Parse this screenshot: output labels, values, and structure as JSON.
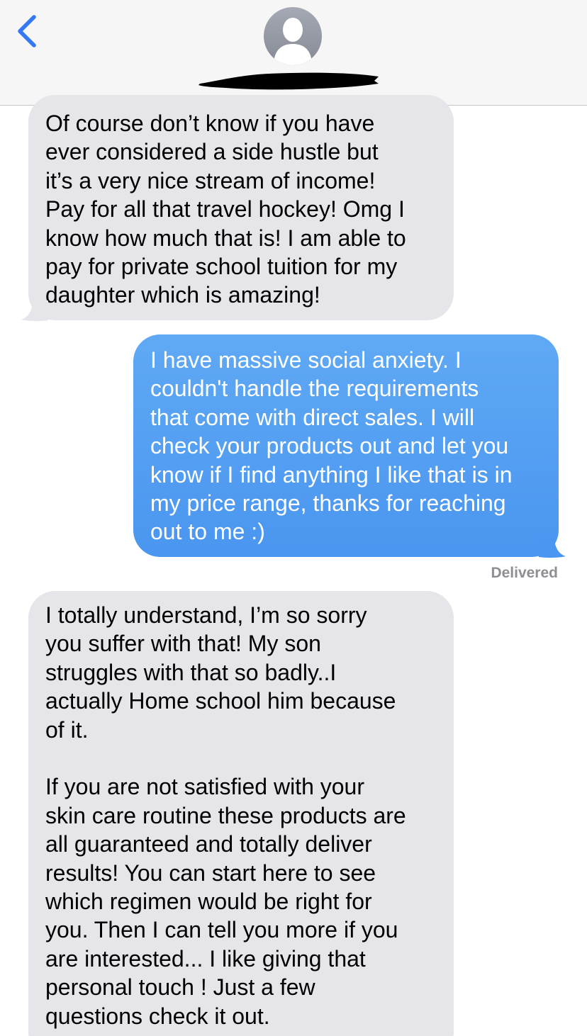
{
  "header": {
    "back_icon": "chevron-left-icon",
    "avatar_icon": "person-silhouette-icon",
    "contact_name_redacted": true
  },
  "messages": [
    {
      "direction": "incoming",
      "text": "Of course don’t know if you have\never considered a side hustle but\nit’s a very nice stream of income!\nPay for all that travel hockey! Omg I\nknow how much that is! I am able to\npay for private school tuition for my\ndaughter which is amazing!"
    },
    {
      "direction": "outgoing",
      "text": "I have massive social anxiety. I\ncouldn't handle the requirements\nthat come with direct sales. I will\ncheck your products out and let you\nknow if I find anything I like that is in\nmy price range, thanks for reaching\nout to me :)",
      "status": "Delivered"
    },
    {
      "direction": "incoming",
      "text": "I totally understand, I’m so sorry\nyou suffer with that! My son\nstruggles with that so badly..I\nactually Home school him because\nof it.\n\nIf you are not satisfied with your\nskin care routine these products are\nall guaranteed and totally deliver\nresults! You can start here to see\nwhich regimen would be right for\nyou. Then I can tell you more if you\nare interested... I like giving that\npersonal touch ! Just a few\nquestions check it out."
    }
  ],
  "colors": {
    "incoming_bubble": "#e5e5ea",
    "outgoing_bubble": "#4a96f0",
    "accent": "#3478f6",
    "status_text": "#8e8e93"
  }
}
